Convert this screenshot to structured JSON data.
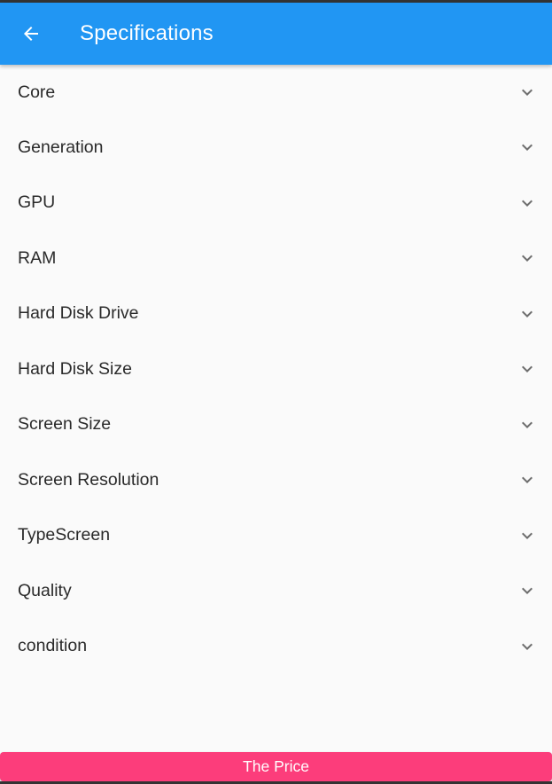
{
  "app_bar": {
    "title": "Specifications",
    "back_icon": "arrow-left-icon",
    "background": "#2196f3"
  },
  "spec_list": {
    "items": [
      {
        "label": "Core",
        "icon": "chevron-down-icon"
      },
      {
        "label": "Generation",
        "icon": "chevron-down-icon"
      },
      {
        "label": "GPU",
        "icon": "chevron-down-icon"
      },
      {
        "label": "RAM",
        "icon": "chevron-down-icon"
      },
      {
        "label": "Hard Disk Drive",
        "icon": "chevron-down-icon"
      },
      {
        "label": "Hard Disk Size",
        "icon": "chevron-down-icon"
      },
      {
        "label": "Screen Size",
        "icon": "chevron-down-icon"
      },
      {
        "label": "Screen Resolution",
        "icon": "chevron-down-icon"
      },
      {
        "label": "TypeScreen",
        "icon": "chevron-down-icon"
      },
      {
        "label": "Quality",
        "icon": "chevron-down-icon"
      },
      {
        "label": "condition",
        "icon": "chevron-down-icon"
      }
    ]
  },
  "footer": {
    "price_button_label": "The Price",
    "price_button_color": "#fc3d7b"
  }
}
